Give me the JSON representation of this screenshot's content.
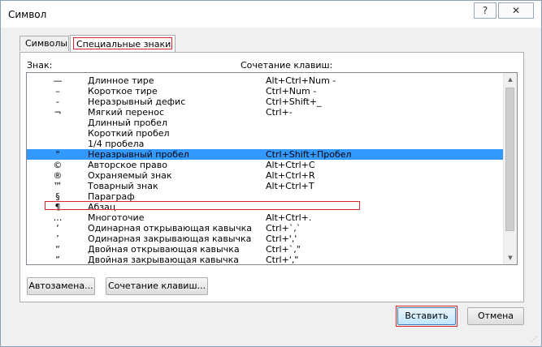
{
  "window": {
    "title": "Символ",
    "help_label": "?",
    "close_label": "✕"
  },
  "tabs": [
    {
      "label": "Символы"
    },
    {
      "label": "Специальные знаки"
    }
  ],
  "list": {
    "header_char": "Знак:",
    "header_keys": "Сочетание клавиш:",
    "rows": [
      {
        "char": "—",
        "name": "Длинное тире",
        "keys": "Alt+Ctrl+Num -"
      },
      {
        "char": "–",
        "name": "Короткое тире",
        "keys": "Ctrl+Num -"
      },
      {
        "char": "‑",
        "name": "Неразрывный дефис",
        "keys": "Ctrl+Shift+_"
      },
      {
        "char": "¬",
        "name": "Мягкий перенос",
        "keys": "Ctrl+-"
      },
      {
        "char": "",
        "name": "Длинный пробел",
        "keys": ""
      },
      {
        "char": "",
        "name": "Короткий пробел",
        "keys": ""
      },
      {
        "char": "",
        "name": "1/4 пробела",
        "keys": ""
      },
      {
        "char": "°",
        "name": "Неразрывный пробел",
        "keys": "Ctrl+Shift+Пробел",
        "selected": true
      },
      {
        "char": "©",
        "name": "Авторское право",
        "keys": "Alt+Ctrl+C"
      },
      {
        "char": "®",
        "name": "Охраняемый знак",
        "keys": "Alt+Ctrl+R"
      },
      {
        "char": "™",
        "name": "Товарный знак",
        "keys": "Alt+Ctrl+T"
      },
      {
        "char": "§",
        "name": "Параграф",
        "keys": ""
      },
      {
        "char": "¶",
        "name": "Абзац",
        "keys": ""
      },
      {
        "char": "…",
        "name": "Многоточие",
        "keys": "Alt+Ctrl+."
      },
      {
        "char": "‘",
        "name": "Одинарная открывающая кавычка",
        "keys": "Ctrl+`,`"
      },
      {
        "char": "’",
        "name": "Одинарная закрывающая кавычка",
        "keys": "Ctrl+','"
      },
      {
        "char": "“",
        "name": "Двойная открывающая кавычка",
        "keys": "Ctrl+`,\""
      },
      {
        "char": "”",
        "name": "Двойная закрывающая кавычка",
        "keys": "Ctrl+',\""
      }
    ]
  },
  "buttons": {
    "autocorrect": "Автозамена...",
    "shortcut": "Сочетание клавиш...",
    "insert": "Вставить",
    "cancel": "Отмена"
  },
  "colors": {
    "selection": "#3399ff",
    "highlight_frame": "#d9262d"
  }
}
